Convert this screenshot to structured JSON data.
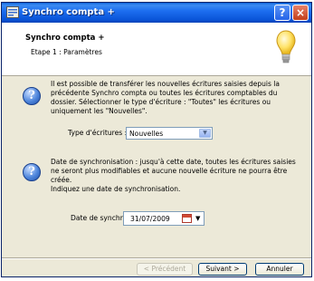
{
  "window": {
    "title": "Synchro compta +",
    "help_button": "?",
    "close_button": "×"
  },
  "header": {
    "title": "Synchro compta +",
    "step": "Etape 1 : Paramètres"
  },
  "section1": {
    "text_lines": [
      "Il est possible de transférer les nouvelles écritures saisies depuis la",
      "précédente Synchro compta ou toutes les écritures comptables du",
      "dossier. Sélectionner le type d'écriture : \"Toutes\" les écritures ou",
      "uniquement les \"Nouvelles\"."
    ],
    "field_label": "Type d'écritures :",
    "field_value": "Nouvelles"
  },
  "section2": {
    "text_lines": [
      "Date de synchronisation : jusqu'à cette date, toutes les écritures saisies",
      "ne seront plus modifiables et aucune nouvelle écriture ne pourra être",
      "créée.",
      "Indiquez une date de synchronisation."
    ],
    "field_label": "Date de synchro :",
    "field_value": "31/07/2009"
  },
  "buttons": {
    "previous": "< Précédent",
    "next": "Suivant >",
    "cancel": "Annuler"
  },
  "icons": {
    "app": "app-icon",
    "bulb": "lightbulb-icon",
    "question": "question-icon",
    "calendar": "calendar-icon",
    "dropdown": "chevron-down-icon"
  }
}
